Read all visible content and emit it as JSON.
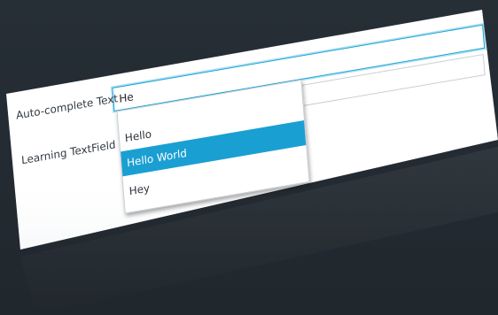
{
  "form": {
    "autocomplete_label": "Auto-complete Text",
    "autocomplete_value": "He",
    "learning_label": "Learning TextField",
    "learning_value": ""
  },
  "dropdown": {
    "items": [
      {
        "label": "Hello",
        "selected": false
      },
      {
        "label": "Hello World",
        "selected": true
      },
      {
        "label": "Hey",
        "selected": false
      }
    ]
  },
  "colors": {
    "accent": "#1a9fd2",
    "background": "#252d35"
  }
}
